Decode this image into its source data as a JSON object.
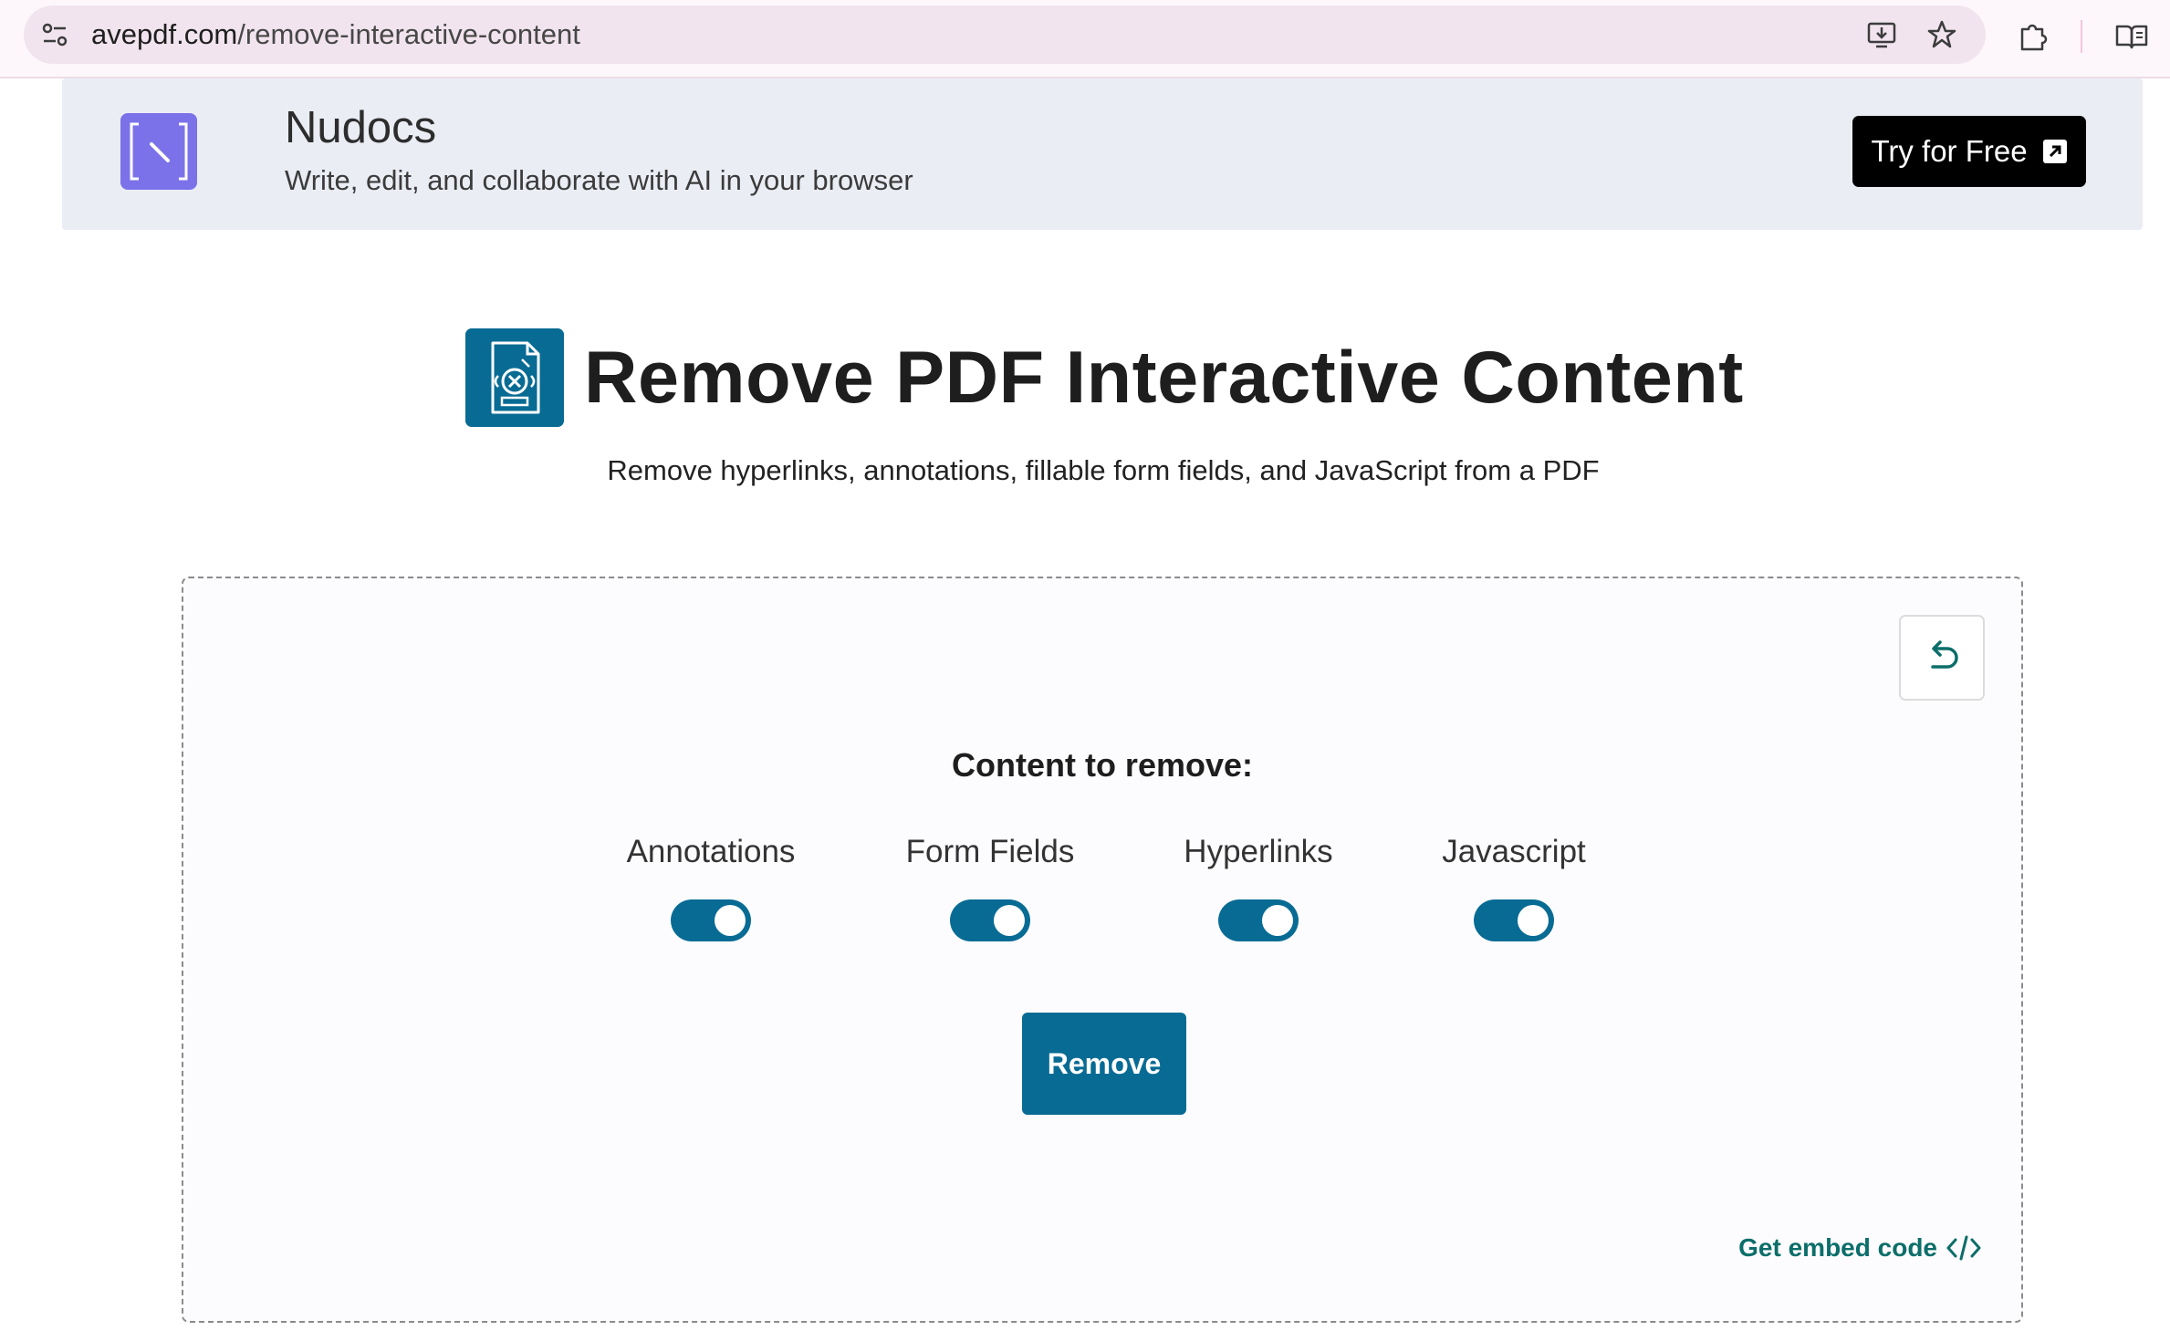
{
  "browser": {
    "url_domain": "avepdf.com",
    "url_path": "/remove-interactive-content"
  },
  "ad": {
    "brand": "Nudocs",
    "tagline": "Write, edit, and collaborate with AI in your browser",
    "cta_label": "Try for Free"
  },
  "header": {
    "title": "Remove PDF Interactive Content",
    "subtitle": "Remove hyperlinks, annotations, fillable form fields, and JavaScript from a PDF"
  },
  "tool": {
    "section_label": "Content to remove:",
    "options": [
      {
        "label": "Annotations",
        "enabled": true
      },
      {
        "label": "Form Fields",
        "enabled": true
      },
      {
        "label": "Hyperlinks",
        "enabled": true
      },
      {
        "label": "Javascript",
        "enabled": true
      }
    ],
    "remove_label": "Remove",
    "embed_label": "Get embed code"
  },
  "colors": {
    "accent": "#086b94",
    "embed_link": "#0c6e6a",
    "ad_background": "#ebedf5",
    "ad_logo": "#7b72e9"
  },
  "icons": {
    "site_info": "tune-icon",
    "install": "install-app-icon",
    "bookmark": "star-icon",
    "extensions": "puzzle-icon",
    "reading_mode": "book-icon",
    "reset": "undo-icon",
    "embed": "code-icon",
    "cta": "external-link-icon"
  }
}
